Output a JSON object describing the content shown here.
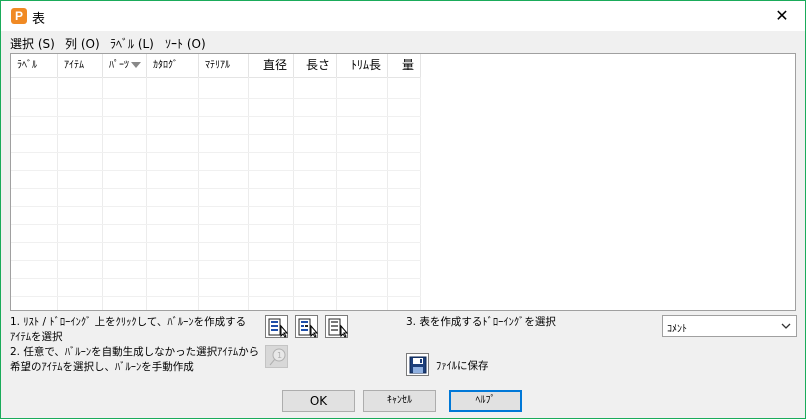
{
  "window": {
    "title": "表",
    "app_icon_letter": "P",
    "close_label": "✕"
  },
  "menu": [
    {
      "label": "選択 (S)"
    },
    {
      "label": "列 (O)"
    },
    {
      "label": "ﾗﾍﾞﾙ (L)"
    },
    {
      "label": "ｿｰﾄ (O)"
    }
  ],
  "table": {
    "columns": [
      {
        "label": "ﾗﾍﾞﾙ"
      },
      {
        "label": "ｱｲﾃﾑ"
      },
      {
        "label": "ﾊﾟｰﾂ"
      },
      {
        "label": "ｶﾀﾛｸﾞ"
      },
      {
        "label": "ﾏﾃﾘｱﾙ"
      },
      {
        "label": "直径"
      },
      {
        "label": "長さ"
      },
      {
        "label": "ﾄﾘﾑ長"
      },
      {
        "label": "量"
      }
    ],
    "rows": []
  },
  "instructions": {
    "step1_line1": "1. ﾘｽﾄ / ﾄﾞﾛｰｲﾝｸﾞ 上をｸﾘｯｸして、ﾊﾞﾙｰﾝを作成する",
    "step1_line2": "ｱｲﾃﾑを選択",
    "step2_line1": "2. 任意で、ﾊﾞﾙｰﾝを自動生成しなかった選択ｱｲﾃﾑから",
    "step2_line2": "希望のｱｲﾃﾑを選択し、ﾊﾞﾙｰﾝを手動作成",
    "step3": "3. 表を作成するﾄﾞﾛｰｲﾝｸﾞを選択"
  },
  "combo": {
    "value": "ｺﾒﾝﾄ"
  },
  "save": {
    "label": "ﾌｧｲﾙに保存"
  },
  "buttons": {
    "ok": "OK",
    "cancel": "ｷｬﾝｾﾙ",
    "help": "ﾍﾙﾌﾟ"
  }
}
